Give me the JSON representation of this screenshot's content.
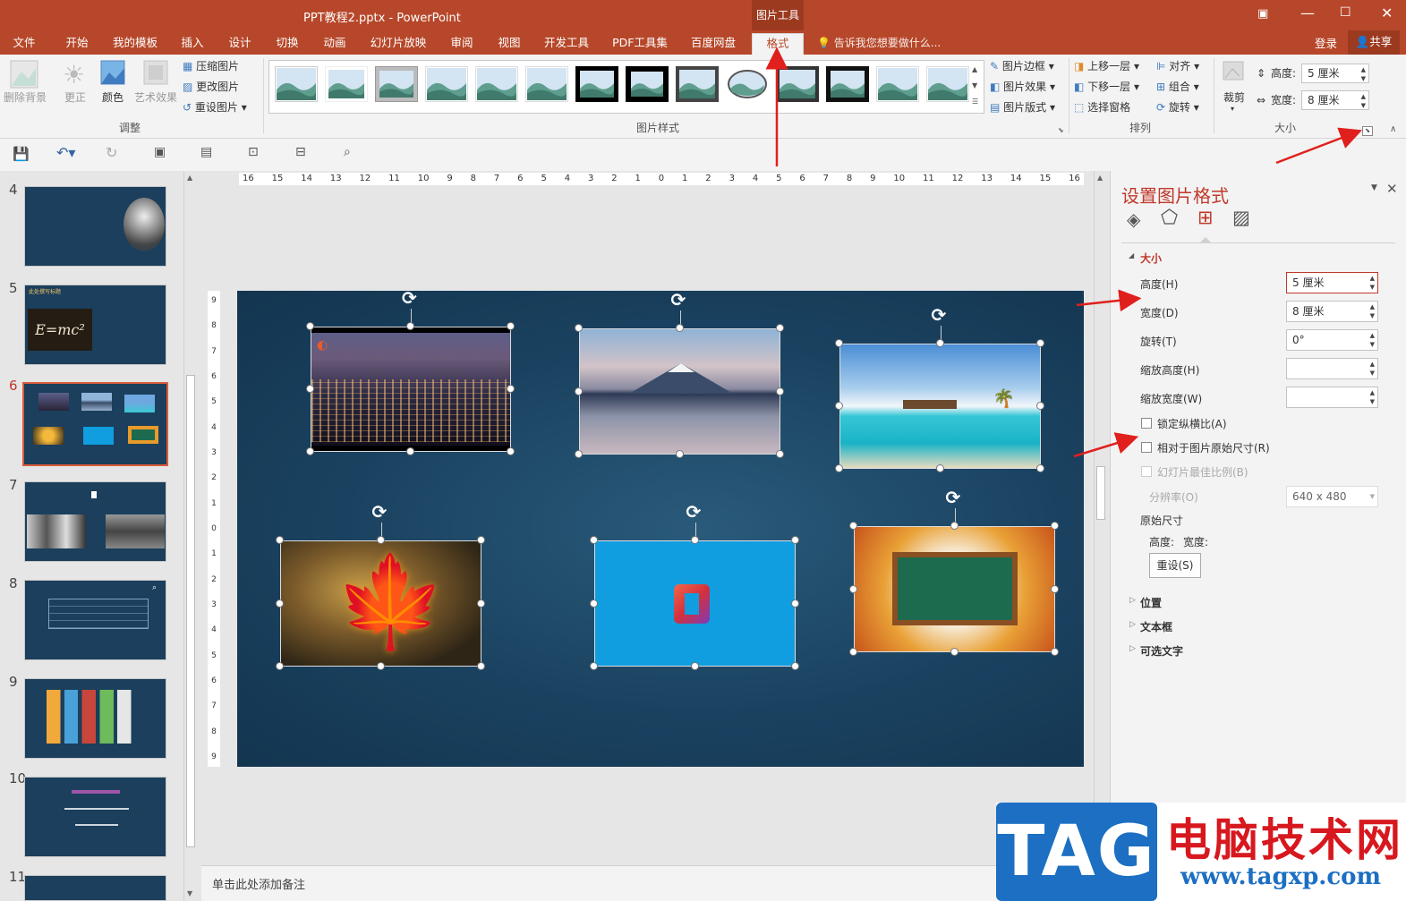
{
  "window": {
    "title": "PPT教程2.pptx - PowerPoint",
    "context_tab_group": "图片工具"
  },
  "tabs": [
    "文件",
    "开始",
    "我的模板",
    "插入",
    "设计",
    "切换",
    "动画",
    "幻灯片放映",
    "审阅",
    "视图",
    "开发工具",
    "PDF工具集",
    "百度网盘",
    "格式"
  ],
  "active_tab": "格式",
  "tell_me": "告诉我您想要做什么...",
  "account": {
    "login": "登录",
    "share": "共享"
  },
  "ribbon": {
    "adjust": {
      "remove_bg": "删除背景",
      "corrections": "更正",
      "color": "颜色",
      "artistic": "艺术效果",
      "compress": "压缩图片",
      "change": "更改图片",
      "reset": "重设图片",
      "group_label": "调整"
    },
    "styles": {
      "group_label": "图片样式",
      "border": "图片边框",
      "effects": "图片效果",
      "layout": "图片版式"
    },
    "arrange": {
      "bring_forward": "上移一层",
      "send_backward": "下移一层",
      "selection_pane": "选择窗格",
      "align": "对齐",
      "group": "组合",
      "rotate": "旋转",
      "group_label": "排列"
    },
    "size": {
      "crop": "裁剪",
      "height_label": "高度:",
      "height_value": "5 厘米",
      "width_label": "宽度:",
      "width_value": "8 厘米",
      "group_label": "大小"
    }
  },
  "slides": [
    {
      "num": "4"
    },
    {
      "num": "5",
      "text": "此处撰写标题",
      "formula": "E=mc²"
    },
    {
      "num": "6"
    },
    {
      "num": "7"
    },
    {
      "num": "8"
    },
    {
      "num": "9"
    },
    {
      "num": "10"
    },
    {
      "num": "11"
    }
  ],
  "active_slide": "6",
  "ruler_h": [
    "16",
    "15",
    "14",
    "13",
    "12",
    "11",
    "10",
    "9",
    "8",
    "7",
    "6",
    "5",
    "4",
    "3",
    "2",
    "1",
    "0",
    "1",
    "2",
    "3",
    "4",
    "5",
    "6",
    "7",
    "8",
    "9",
    "10",
    "11",
    "12",
    "13",
    "14",
    "15",
    "16"
  ],
  "ruler_v": [
    "9",
    "8",
    "7",
    "6",
    "5",
    "4",
    "3",
    "2",
    "1",
    "0",
    "1",
    "2",
    "3",
    "4",
    "5",
    "6",
    "7",
    "8",
    "9"
  ],
  "notes_placeholder": "单击此处添加备注",
  "format_pane": {
    "title": "设置图片格式",
    "section_size": "大小",
    "height_label": "高度(H)",
    "height_value": "5 厘米",
    "width_label": "宽度(D)",
    "width_value": "8 厘米",
    "rotation_label": "旋转(T)",
    "rotation_value": "0°",
    "scale_h_label": "缩放高度(H)",
    "scale_h_value": "",
    "scale_w_label": "缩放宽度(W)",
    "scale_w_value": "",
    "lock_aspect": "锁定纵横比(A)",
    "relative_original": "相对于图片原始尺寸(R)",
    "best_scale": "幻灯片最佳比例(B)",
    "resolution_label": "分辨率(O)",
    "resolution_value": "640 x 480",
    "original_size": "原始尺寸",
    "orig_height": "高度:",
    "orig_width": "宽度:",
    "reset": "重设(S)",
    "section_position": "位置",
    "section_textbox": "文本框",
    "section_alt": "可选文字"
  },
  "watermark": {
    "tag": "TAG",
    "site_name": "电脑技术网",
    "url": "www.tagxp.com"
  },
  "colors": {
    "accent": "#b7472a",
    "slide_bg": "#1a4260",
    "arrow": "#e0201c"
  }
}
